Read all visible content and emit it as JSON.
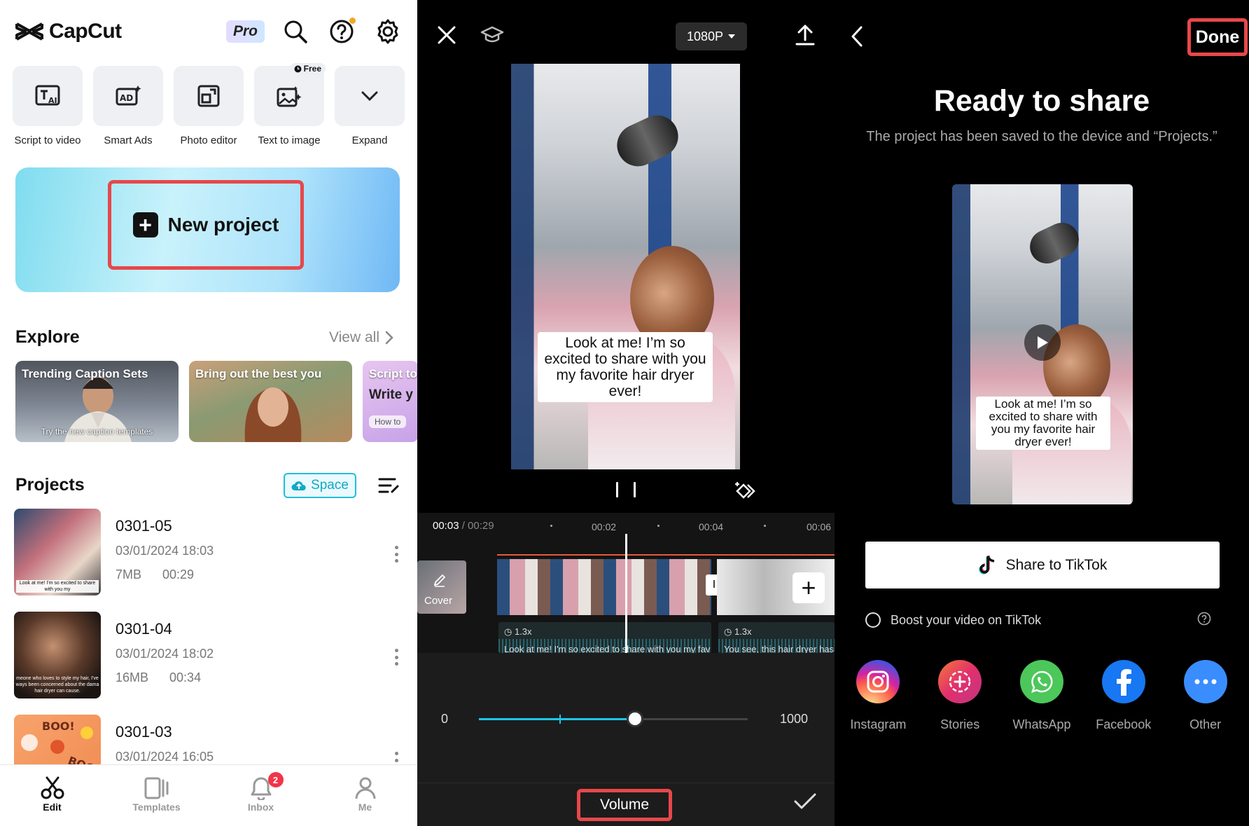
{
  "panel1": {
    "logo_text": "CapCut",
    "pro_label": "Pro",
    "tools": [
      {
        "label": "Script to video",
        "icon": "script-to-video-icon"
      },
      {
        "label": "Smart Ads",
        "icon": "smart-ads-icon"
      },
      {
        "label": "Photo editor",
        "icon": "photo-editor-icon"
      },
      {
        "label": "Text to image",
        "icon": "text-to-image-icon",
        "tag": "Free"
      },
      {
        "label": "Expand",
        "icon": "chevron-down-icon"
      }
    ],
    "new_project_label": "New project",
    "explore": {
      "title": "Explore",
      "view_all": "View all",
      "cards": [
        {
          "title": "Trending Caption Sets",
          "subtitle": "Try the new caption templates"
        },
        {
          "title": "Bring out the best you",
          "subtitle": ""
        },
        {
          "title": "Script to",
          "inner": "Write y",
          "pill": "How to"
        }
      ]
    },
    "projects": {
      "title": "Projects",
      "space_label": "Space",
      "items": [
        {
          "name": "0301-05",
          "date": "03/01/2024 18:03",
          "size": "7MB",
          "duration": "00:29",
          "thumb_caption": "Look at me! I'm so excited to share with you my"
        },
        {
          "name": "0301-04",
          "date": "03/01/2024 18:02",
          "size": "16MB",
          "duration": "00:34",
          "thumb_caption": "meone who loves to style my hair, I've ways been concerned about the dama hair dryer can cause."
        },
        {
          "name": "0301-03",
          "date": "03/01/2024 16:05",
          "size": "",
          "duration": "",
          "thumb_caption": ""
        }
      ]
    },
    "nav": [
      {
        "label": "Edit",
        "active": true
      },
      {
        "label": "Templates"
      },
      {
        "label": "Inbox",
        "badge": "2"
      },
      {
        "label": "Me"
      }
    ]
  },
  "panel2": {
    "resolution": "1080P",
    "caption": "Look at me! I’m so excited to share with you my favorite hair dryer ever!",
    "time_current": "00:03",
    "time_total": "/ 00:29",
    "ticks": [
      "00:02",
      "00:04",
      "00:06"
    ],
    "cover_label": "Cover",
    "speed1": "1.3x",
    "speed2": "1.3x",
    "audio1_text": "Look at me! I'm so excited to share with you my fav",
    "audio2_text": "You see, this hair dryer has",
    "slider": {
      "min_label": "0",
      "max_label": "1000",
      "min": 0,
      "max": 1000,
      "value": 580,
      "marker": 300
    },
    "volume_label": "Volume"
  },
  "panel3": {
    "done_label": "Done",
    "title": "Ready to share",
    "subtitle": "The project has been saved to the device and “Projects.”",
    "caption": "Look at me! I’m so excited to share with you my favorite hair dryer ever!",
    "tiktok_label": "Share to TikTok",
    "boost_label": "Boost your video on TikTok",
    "socials": [
      {
        "label": "Instagram",
        "color": "#dd2a7b"
      },
      {
        "label": "Stories",
        "color": "#f03e7a"
      },
      {
        "label": "WhatsApp",
        "color": "#4cc75a"
      },
      {
        "label": "Facebook",
        "color": "#1877f2"
      },
      {
        "label": "Other",
        "color": "#3a8dff"
      }
    ]
  }
}
